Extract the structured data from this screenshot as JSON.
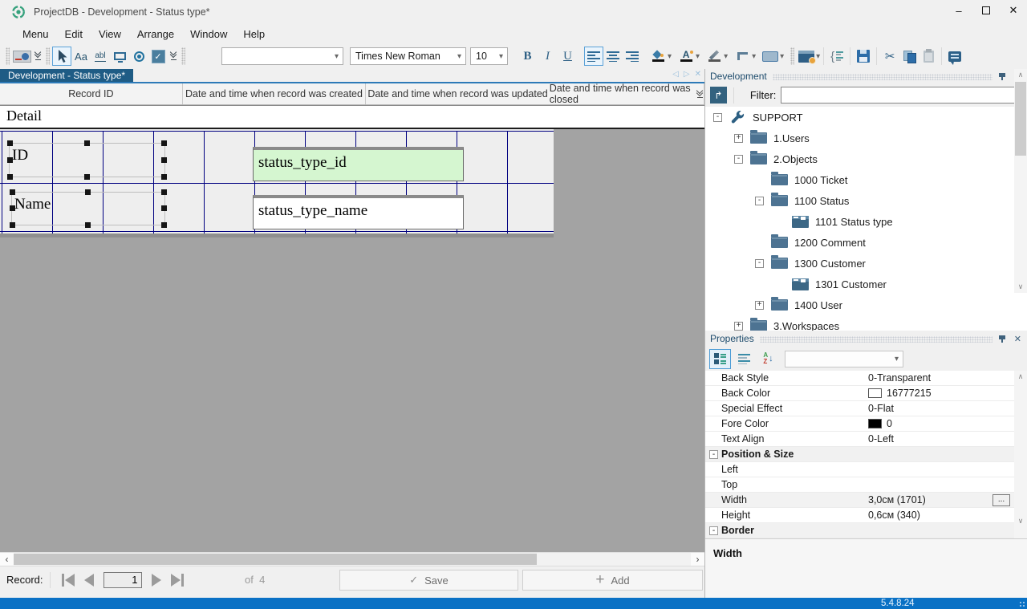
{
  "window": {
    "title": "ProjectDB - Development - Status type*"
  },
  "colors": {
    "accent_tab": "#1f5c85",
    "status_bar": "#0a71c5",
    "grid_line": "#000080",
    "id_field_bg": "#d5f6d0"
  },
  "icons": {
    "minimize_glyph": "–",
    "close_glyph": "✕",
    "combo_arrow_glyph": "▾",
    "bold_label": "B",
    "italic_label": "I",
    "underline_label": "U",
    "label_tool_glyph": "Aa",
    "textbox_tool_glyph": "abl",
    "cut_glyph": "✂",
    "check_glyph": "✓",
    "plus_glyph": "+",
    "scroll_left_glyph": "‹",
    "scroll_right_glyph": "›",
    "scroll_up_glyph": "∧",
    "scroll_down_glyph": "∨",
    "tab_prev_glyph": "◁",
    "tab_next_glyph": "▷",
    "tab_close_glyph": "✕",
    "filter_redirect_glyph": "↱",
    "ellipsis_label": "..."
  },
  "menu": {
    "items": [
      {
        "label": "Menu"
      },
      {
        "label": "Edit"
      },
      {
        "label": "View"
      },
      {
        "label": "Arrange"
      },
      {
        "label": "Window"
      },
      {
        "label": "Help"
      }
    ]
  },
  "toolbar": {
    "style_combo_value": "",
    "font_name": "Times New Roman",
    "font_size": "10"
  },
  "tab": {
    "label": "Development - Status type*"
  },
  "columns": {
    "headers": [
      {
        "label": "Record ID"
      },
      {
        "label": "Date and time when record was created"
      },
      {
        "label": "Date and time when record was updated"
      },
      {
        "label": "Date and time when record was closed"
      }
    ]
  },
  "designer": {
    "band_label": "Detail",
    "id_label": "ID",
    "name_label": "Name",
    "id_field_value": "status_type_id",
    "name_field_value": "status_type_name",
    "id_field_style": "background:#d5f6d0",
    "name_field_style": "background:#ffffff"
  },
  "dev_panel": {
    "title": "Development",
    "filter_label": "Filter:",
    "filter_value": "",
    "tree": [
      {
        "level": 1,
        "expander": "minus",
        "icon": "wrench",
        "label": "SUPPORT"
      },
      {
        "level": 2,
        "expander": "plus",
        "icon": "folder",
        "label": "1.Users"
      },
      {
        "level": 2,
        "expander": "minus",
        "icon": "folder",
        "label": "2.Objects"
      },
      {
        "level": 3,
        "expander": "none",
        "icon": "folder",
        "label": "1000 Ticket"
      },
      {
        "level": 3,
        "expander": "minus",
        "icon": "folder",
        "label": "1100 Status"
      },
      {
        "level": 4,
        "expander": "none",
        "icon": "form",
        "label": "1101 Status type"
      },
      {
        "level": 3,
        "expander": "none",
        "icon": "folder",
        "label": "1200 Comment"
      },
      {
        "level": 3,
        "expander": "minus",
        "icon": "folder",
        "label": "1300 Customer"
      },
      {
        "level": 4,
        "expander": "none",
        "icon": "form",
        "label": "1301 Customer"
      },
      {
        "level": 3,
        "expander": "plus",
        "icon": "folder",
        "label": "1400 User"
      },
      {
        "level": 2,
        "expander": "plus",
        "icon": "folder",
        "label": "3.Workspaces"
      }
    ]
  },
  "properties_panel": {
    "title": "Properties",
    "selector_value": "",
    "rows": [
      {
        "type": "prop",
        "label": "Back Style",
        "value": "0-Transparent"
      },
      {
        "type": "prop",
        "label": "Back Color",
        "value": "16777215",
        "swatch": "#ffffff"
      },
      {
        "type": "prop",
        "label": "Special Effect",
        "value": "0-Flat"
      },
      {
        "type": "prop",
        "label": "Fore Color",
        "value": "0",
        "swatch": "#000000"
      },
      {
        "type": "prop",
        "label": "Text Align",
        "value": "0-Left"
      },
      {
        "type": "group",
        "label": "Position & Size"
      },
      {
        "type": "prop",
        "label": "Left",
        "value": ""
      },
      {
        "type": "prop",
        "label": "Top",
        "value": ""
      },
      {
        "type": "prop",
        "label": "Width",
        "value": "3,0см (1701)",
        "ellipsis": true,
        "selected": true
      },
      {
        "type": "prop",
        "label": "Height",
        "value": "0,6см (340)"
      },
      {
        "type": "group",
        "label": "Border"
      }
    ],
    "description_title": "Width"
  },
  "record_bar": {
    "label": "Record:",
    "current": "1",
    "count": "of  4",
    "save_label": "Save",
    "add_label": "Add"
  },
  "status_bar": {
    "version": "5.4.8.24"
  }
}
